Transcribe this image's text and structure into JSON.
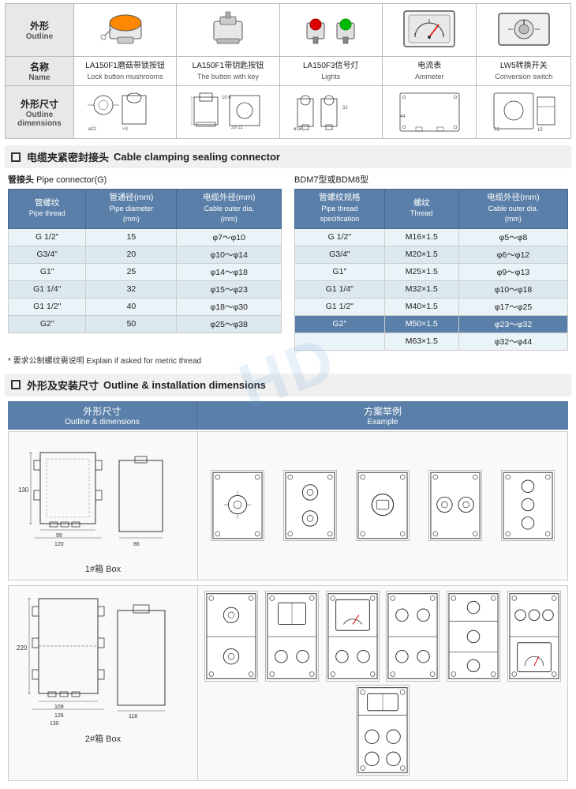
{
  "products": {
    "rows": [
      {
        "labels": [
          {
            "cn": "外形",
            "en": "Outline"
          },
          {
            "cn": "名称",
            "en": "Name"
          },
          {
            "cn": "外形尺寸",
            "en": "Outline dimensions"
          }
        ],
        "items": [
          {
            "id": "la150f1-mushroom",
            "name_cn": "LA150F1磨菇带锁按钮",
            "name_en": "Lock button mushrooms"
          },
          {
            "id": "la150f1-key",
            "name_cn": "LA150F1带钥匙按钮",
            "name_en": "The button with key"
          },
          {
            "id": "la150f3-light",
            "name_cn": "LA150F3信号灯",
            "name_en": "Lights"
          },
          {
            "id": "ammeter",
            "name_cn": "电流表",
            "name_en": "Ammeter"
          },
          {
            "id": "lw5-switch",
            "name_cn": "LW5转换开关",
            "name_en": "Conversion switch"
          }
        ]
      }
    ]
  },
  "cable_section": {
    "title_cn": "电缆夹紧密封接头",
    "title_en": "Cable clamping sealing connector",
    "pipe_connector": {
      "label_cn": "管接头",
      "label_en": "Pipe connector(G)",
      "headers": [
        "管螺纹\nPipe thread",
        "管通径(mm)\nPipe diameter\n(mm)",
        "电缆外径(mm)\nCable outer dia.\n(mm)"
      ],
      "header_lines": [
        [
          "管螺纹",
          "Pipe thread"
        ],
        [
          "管通径(mm)",
          "Pipe diameter",
          "(mm)"
        ],
        [
          "电缆外径(mm)",
          "Cable outer dia.",
          "(mm)"
        ]
      ],
      "rows": [
        [
          "G 1/2\"",
          "15",
          "φ7～φ10"
        ],
        [
          "G3/4\"",
          "20",
          "φ10～φ14"
        ],
        [
          "G1\"",
          "25",
          "φ14～φ18"
        ],
        [
          "G1 1/4\"",
          "32",
          "φ15～φ23"
        ],
        [
          "G1 1/2\"",
          "40",
          "φ18～φ30"
        ],
        [
          "G2\"",
          "50",
          "φ25～φ38"
        ]
      ]
    },
    "bdm_connector": {
      "label": "BDM7型或BDM8型",
      "headers": [
        [
          "管螺纹规格",
          "Pipe thread",
          "specification"
        ],
        [
          "螺纹",
          "Thread"
        ],
        [
          "电缆外径(mm)",
          "Cable outer dia.",
          "(mm)"
        ]
      ],
      "rows": [
        [
          "G 1/2\"",
          "M16×1.5",
          "φ5～φ8",
          false
        ],
        [
          "G3/4\"",
          "M20×1.5",
          "φ6～φ12",
          false
        ],
        [
          "G1\"",
          "M25×1.5",
          "φ9～φ13",
          false
        ],
        [
          "G1 1/4\"",
          "M32×1.5",
          "φ10～φ18",
          false
        ],
        [
          "G1 1/2\"",
          "M40×1.5",
          "φ17～φ25",
          false
        ],
        [
          "G2\"",
          "M50×1.5",
          "φ23～φ32",
          true
        ],
        [
          "",
          "M63×1.5",
          "φ32～φ44",
          false
        ]
      ]
    },
    "footnote": "* 要求公制螺纹需说明  Explain if asked for metric thread"
  },
  "outline_section": {
    "title_cn": "外形及安装尺寸",
    "title_en": "Outline & installation dimensions",
    "col_left_cn": "外形尺寸",
    "col_left_en": "Outline & dimensions",
    "col_right_cn": "方案举例",
    "col_right_en": "Example",
    "boxes": [
      {
        "label_cn": "1#箱",
        "label_en": "Box",
        "height_label": "130"
      },
      {
        "label_cn": "2#箱",
        "label_en": "Box",
        "height_label": "220"
      }
    ]
  }
}
